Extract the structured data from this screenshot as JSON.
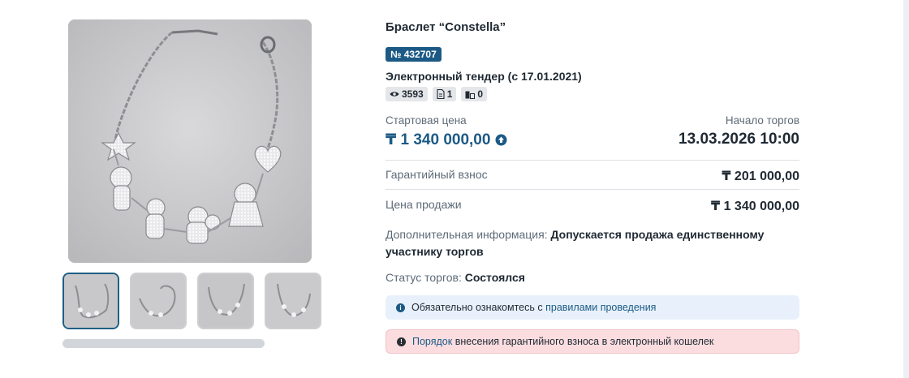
{
  "lot": {
    "title": "Браслет “Constella”",
    "number_badge": "№ 432707",
    "tender_type": "Электронный тендер (с 17.01.2021)",
    "counters": [
      {
        "icon": "eye-icon",
        "value": "3593"
      },
      {
        "icon": "document-icon",
        "value": "1"
      },
      {
        "icon": "participants-icon",
        "value": "0"
      }
    ]
  },
  "pricing": {
    "start_price_label": "Стартовая цена",
    "start_price_value": "₸ 1 340 000,00",
    "start_price_icon": "arrow-up-circle-icon",
    "start_time_label": "Начало торгов",
    "start_time_value": "13.03.2026 10:00",
    "deposit_label": "Гарантийный взнос",
    "deposit_value": "₸ 201 000,00",
    "sale_price_label": "Цена продажи",
    "sale_price_value": "₸ 1 340 000,00"
  },
  "info": {
    "extra_label": "Дополнительная информация:",
    "extra_value": "Допускается продажа единственному участнику торгов",
    "status_label": "Статус торгов:",
    "status_value": "Состоялся"
  },
  "alerts": {
    "info_prefix": "Обязательно ознакомтесь с",
    "info_link": "правилами проведения",
    "warn_link": "Порядок",
    "warn_suffix": "внесения гарантийного взноса в электронный кошелек"
  },
  "gallery": {
    "thumb_count": 4,
    "active_index": 0
  },
  "colors": {
    "accent": "#1c5a85",
    "text": "#1f2933",
    "muted": "#5e6b78",
    "info_bg": "#e8f1fb",
    "warn_bg": "#fbdde0"
  }
}
